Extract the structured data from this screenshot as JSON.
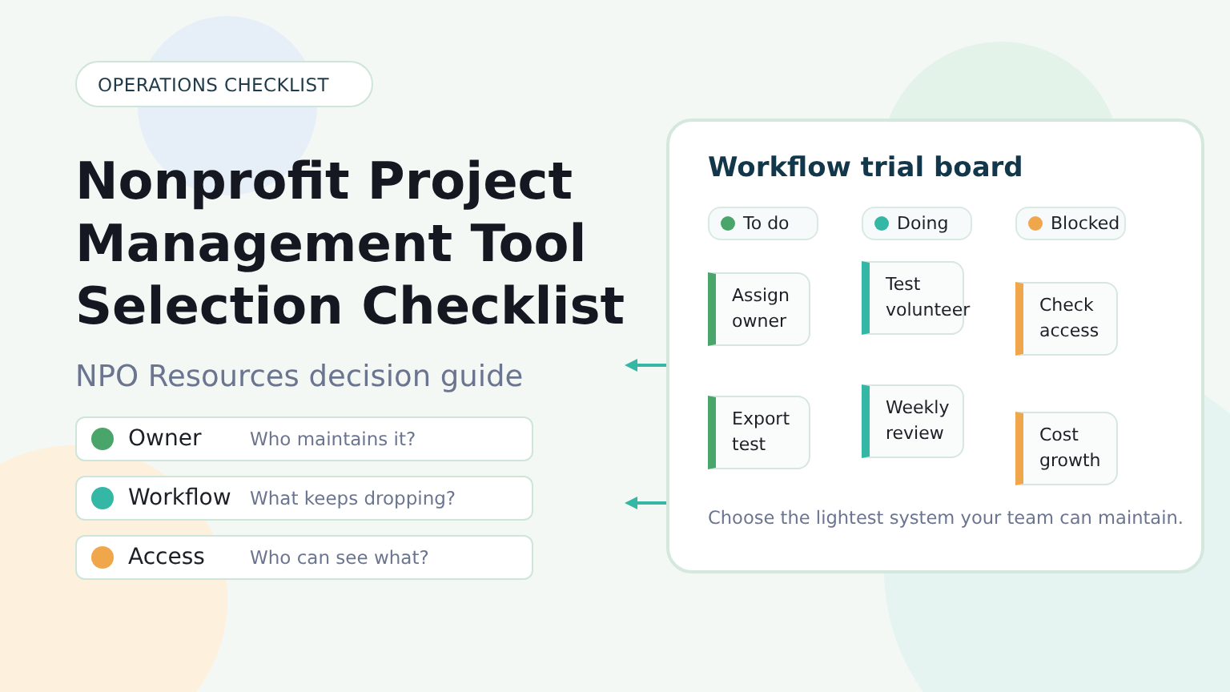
{
  "badge": "OPERATIONS CHECKLIST",
  "title": [
    "Nonprofit Project",
    "Management Tool",
    "Selection Checklist"
  ],
  "subtitle": "NPO Resources decision guide",
  "criteria": [
    {
      "label": "Owner",
      "question": "Who maintains it?",
      "color": "#4aa56a"
    },
    {
      "label": "Workflow",
      "question": "What keeps dropping?",
      "color": "#35b7a5"
    },
    {
      "label": "Access",
      "question": "Who can see what?",
      "color": "#f0a64a"
    }
  ],
  "board": {
    "title": "Workflow trial board",
    "columns": [
      {
        "label": "To do",
        "color": "#4aa56a",
        "cards": [
          "Assign owner",
          "Export test"
        ]
      },
      {
        "label": "Doing",
        "color": "#35b7a5",
        "cards": [
          "Test volunteer",
          "Weekly review"
        ]
      },
      {
        "label": "Blocked",
        "color": "#f0a64a",
        "cards": [
          "Check access",
          "Cost growth"
        ]
      }
    ],
    "footer": "Choose the lightest system your team can maintain."
  }
}
